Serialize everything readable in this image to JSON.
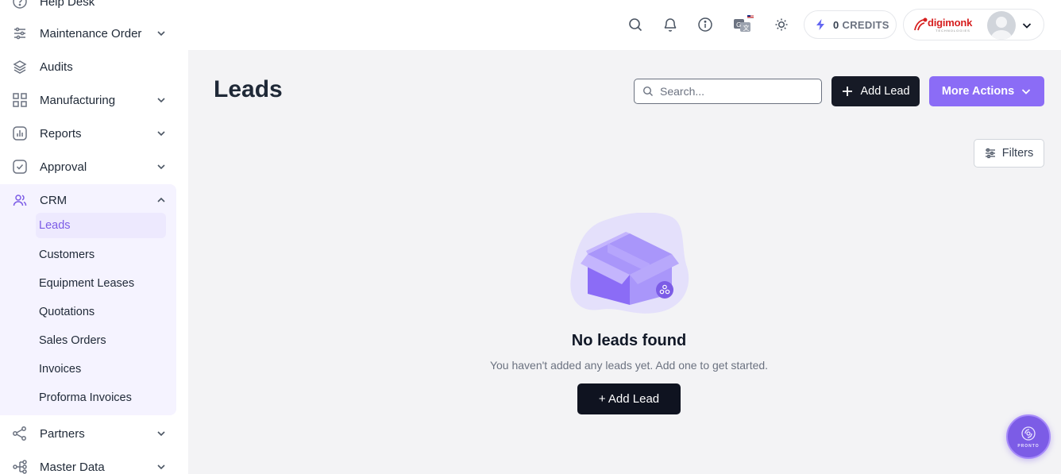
{
  "sidebar": {
    "items": [
      {
        "label": "Help Desk",
        "icon": "help-circle-icon"
      },
      {
        "label": "Maintenance Order",
        "icon": "sliders-icon"
      },
      {
        "label": "Audits",
        "icon": "layers-icon"
      },
      {
        "label": "Manufacturing",
        "icon": "grid-icon"
      },
      {
        "label": "Reports",
        "icon": "bar-chart-icon"
      },
      {
        "label": "Approval",
        "icon": "check-square-icon"
      },
      {
        "label": "CRM",
        "icon": "users-icon"
      },
      {
        "label": "Partners",
        "icon": "share-icon"
      },
      {
        "label": "Master Data",
        "icon": "hierarchy-icon"
      }
    ],
    "crm_sub": [
      {
        "label": "Leads",
        "active": true
      },
      {
        "label": "Customers"
      },
      {
        "label": "Equipment Leases"
      },
      {
        "label": "Quotations"
      },
      {
        "label": "Sales Orders"
      },
      {
        "label": "Invoices"
      },
      {
        "label": "Proforma Invoices"
      }
    ]
  },
  "topbar": {
    "icons": [
      "search-icon",
      "bell-icon",
      "info-icon",
      "translate-icon",
      "sun-icon"
    ],
    "credits": {
      "count": "0",
      "label": "CREDITS"
    },
    "brand": {
      "name": "digimonk",
      "tagline": "TECHNOLOGIES",
      "color": "#d61f1f"
    }
  },
  "main": {
    "title": "Leads",
    "search_placeholder": "Search...",
    "add_lead_label": "Add Lead",
    "more_actions_label": "More Actions",
    "filters_label": "Filters",
    "empty": {
      "title": "No leads found",
      "subtitle": "You haven't added any leads yet. Add one to get started.",
      "button_label": "+ Add Lead"
    }
  },
  "assistant": {
    "label": "PRONTO"
  },
  "colors": {
    "accent": "#8b6cf6",
    "dark": "#161a26",
    "active_bg": "#ede9fe"
  }
}
